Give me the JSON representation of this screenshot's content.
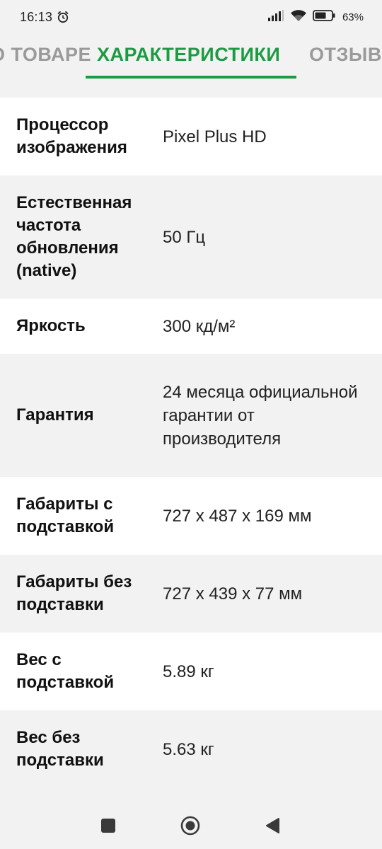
{
  "status_bar": {
    "time": "16:13",
    "battery": "63%",
    "icons": [
      "alarm-icon",
      "signal-icon",
      "wifi-icon",
      "battery-icon"
    ]
  },
  "tabs": [
    {
      "label": "О ТОВАРЕ",
      "active": false
    },
    {
      "label": "ХАРАКТЕРИСТИКИ",
      "active": true
    },
    {
      "label": "ОТЗЫВЫ",
      "active": false
    }
  ],
  "specs": [
    {
      "label": "Процессор изображения",
      "value": "Pixel Plus HD"
    },
    {
      "label": "Естественная частота обновления (native)",
      "value": "50 Гц"
    },
    {
      "label": "Яркость",
      "value": "300 кд/м²"
    },
    {
      "label": "Гарантия",
      "value": "24 месяца официальной гарантии от производителя"
    },
    {
      "label": "Габариты с подставкой",
      "value": "727 x 487 x 169 мм"
    },
    {
      "label": "Габариты без подставки",
      "value": "727 x 439 x 77 мм"
    },
    {
      "label": "Вес с подставкой",
      "value": "5.89 кг"
    },
    {
      "label": "Вес без подставки",
      "value": "5.63 кг"
    }
  ],
  "nav": {
    "icons": [
      "recents-square-icon",
      "home-circle-icon",
      "back-triangle-icon"
    ]
  },
  "colors": {
    "accent": "#1d9a43",
    "inactive_tab": "#9a9a9a",
    "row_white": "#ffffff",
    "row_gray": "#f2f2f2"
  }
}
